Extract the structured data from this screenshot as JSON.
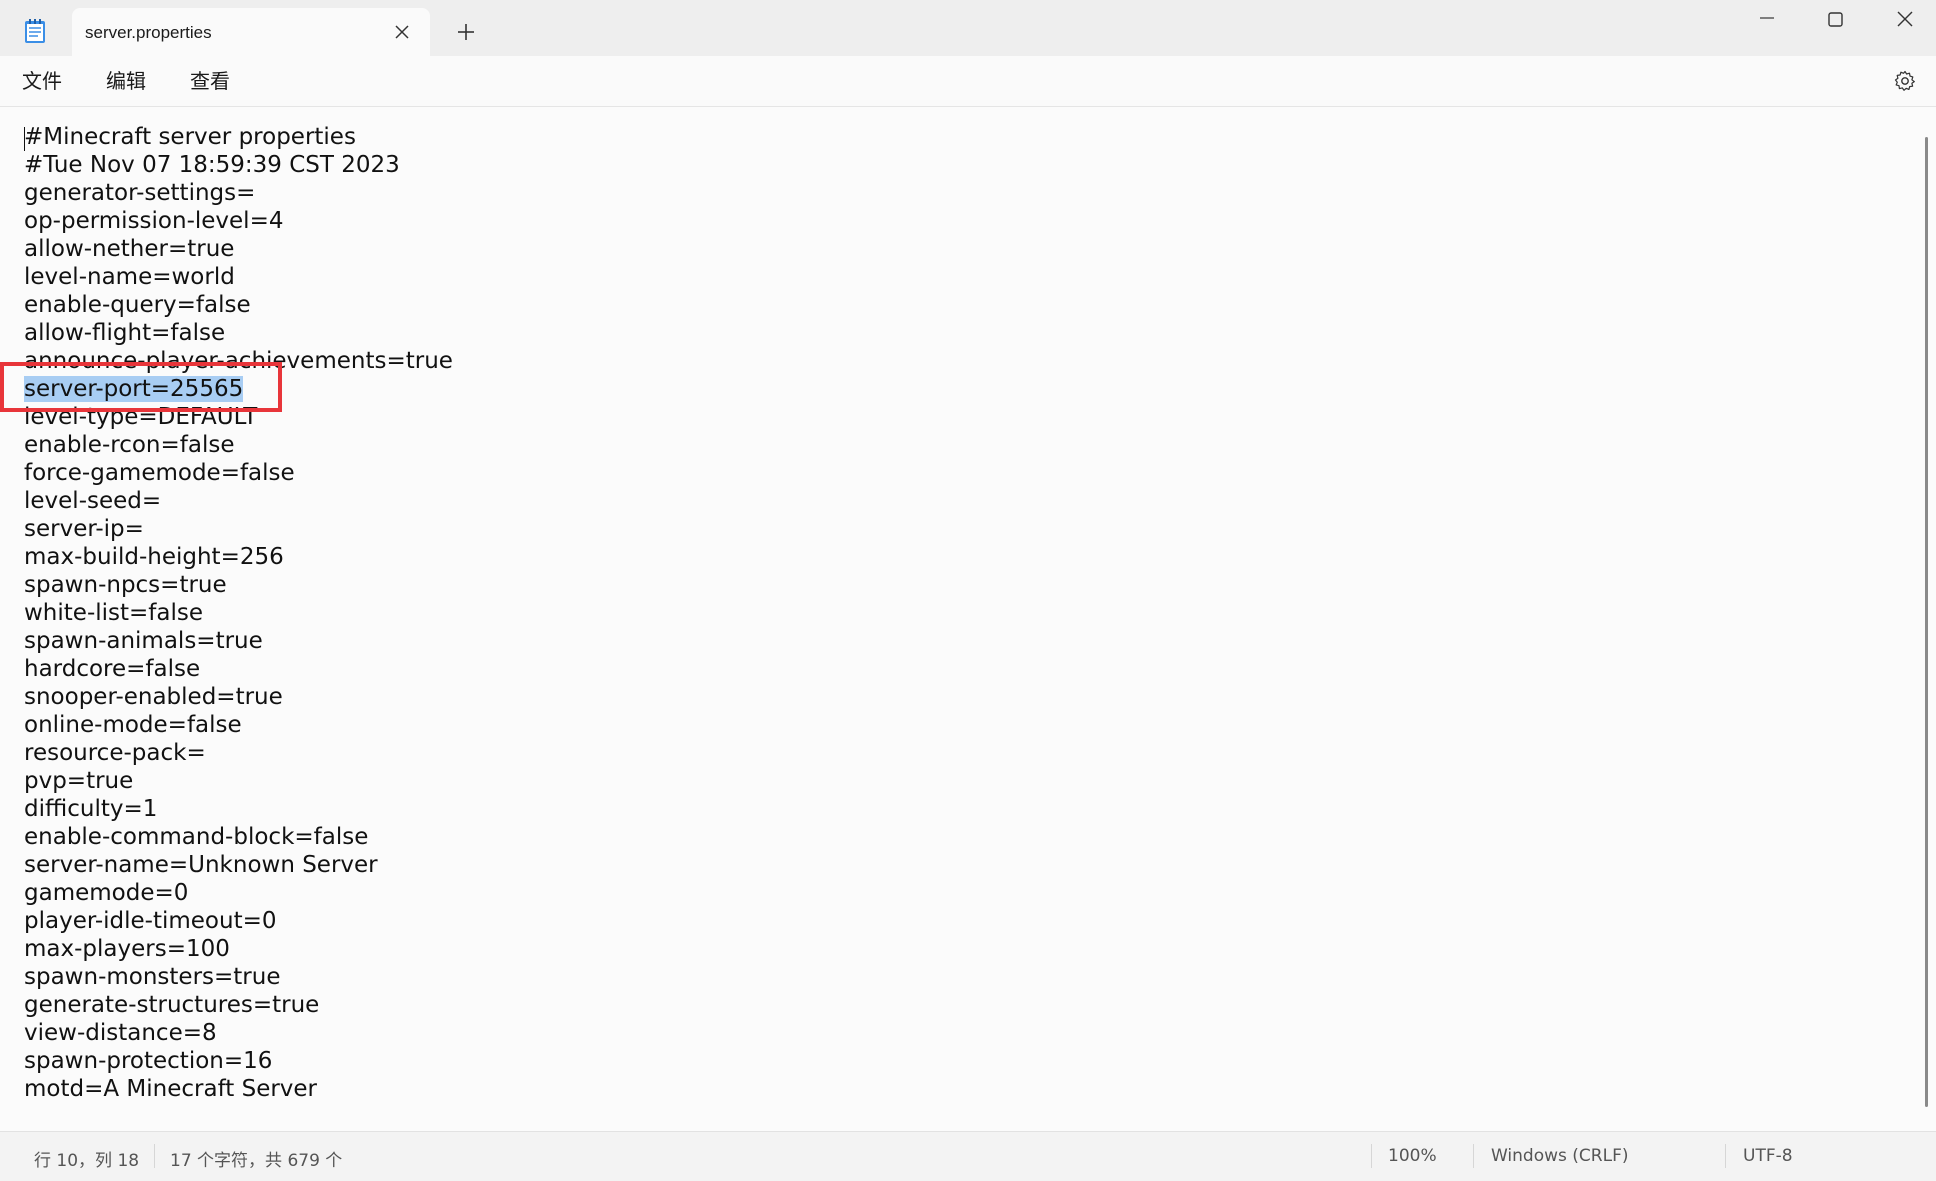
{
  "window": {
    "tab_title": "server.properties",
    "new_tab_symbol": "+"
  },
  "menu": {
    "file": "文件",
    "edit": "编辑",
    "view": "查看"
  },
  "editor": {
    "lines": [
      "#Minecraft server properties",
      "#Tue Nov 07 18:59:39 CST 2023",
      "generator-settings=",
      "op-permission-level=4",
      "allow-nether=true",
      "level-name=world",
      "enable-query=false",
      "allow-flight=false",
      "announce-player-achievements=true",
      "server-port=25565",
      "level-type=DEFAULT",
      "enable-rcon=false",
      "force-gamemode=false",
      "level-seed=",
      "server-ip=",
      "max-build-height=256",
      "spawn-npcs=true",
      "white-list=false",
      "spawn-animals=true",
      "hardcore=false",
      "snooper-enabled=true",
      "online-mode=false",
      "resource-pack=",
      "pvp=true",
      "difficulty=1",
      "enable-command-block=false",
      "server-name=Unknown Server",
      "gamemode=0",
      "player-idle-timeout=0",
      "max-players=100",
      "spawn-monsters=true",
      "generate-structures=true",
      "view-distance=8",
      "spawn-protection=16",
      "motd=A Minecraft Server"
    ],
    "selected_line_index": 9,
    "highlight_color": "#e8353a",
    "selection_color": "#a8cdf3"
  },
  "status": {
    "position": "行 10，列 18",
    "count": "17 个字符，共 679 个",
    "zoom": "100%",
    "line_ending": "Windows (CRLF)",
    "encoding": "UTF-8"
  },
  "icons": {
    "app": "notepad-icon",
    "tab_close": "close-icon",
    "new_tab": "plus-icon",
    "minimize": "minimize-icon",
    "maximize": "maximize-icon",
    "close": "close-icon",
    "settings": "gear-icon"
  }
}
